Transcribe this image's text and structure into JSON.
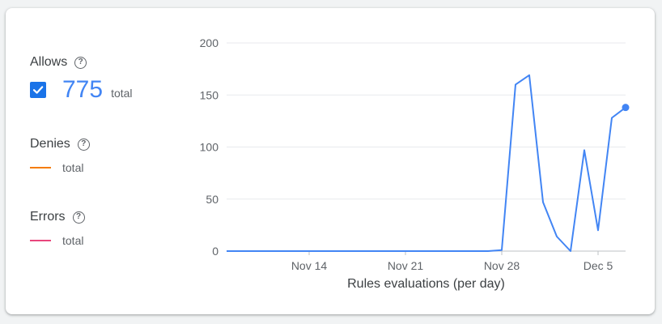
{
  "legend": {
    "allows": {
      "label": "Allows",
      "value": "775",
      "unit": "total",
      "checked": true
    },
    "denies": {
      "label": "Denies",
      "unit": "total",
      "color": "#f57c00"
    },
    "errors": {
      "label": "Errors",
      "unit": "total",
      "color": "#e8467c"
    },
    "help_glyph": "?"
  },
  "chart_data": {
    "type": "line",
    "xlabel": "Rules evaluations (per day)",
    "ylabel": "",
    "x_ticks": [
      "Nov 14",
      "Nov 21",
      "Nov 28",
      "Dec 5"
    ],
    "y_ticks": [
      0,
      50,
      100,
      150,
      200
    ],
    "ylim": [
      0,
      200
    ],
    "x_range": [
      "Nov 8",
      "Dec 7"
    ],
    "grid": true,
    "series": [
      {
        "name": "Allows",
        "color": "#4285f4",
        "x": [
          "Nov 8",
          "Nov 9",
          "Nov 10",
          "Nov 11",
          "Nov 12",
          "Nov 13",
          "Nov 14",
          "Nov 15",
          "Nov 16",
          "Nov 17",
          "Nov 18",
          "Nov 19",
          "Nov 20",
          "Nov 21",
          "Nov 22",
          "Nov 23",
          "Nov 24",
          "Nov 25",
          "Nov 26",
          "Nov 27",
          "Nov 28",
          "Nov 29",
          "Nov 30",
          "Dec 1",
          "Dec 2",
          "Dec 3",
          "Dec 4",
          "Dec 5",
          "Dec 6",
          "Dec 7"
        ],
        "values": [
          0,
          0,
          0,
          0,
          0,
          0,
          0,
          0,
          0,
          0,
          0,
          0,
          0,
          0,
          0,
          0,
          0,
          0,
          0,
          0,
          1,
          160,
          169,
          47,
          14,
          0,
          97,
          20,
          128,
          138
        ]
      }
    ]
  }
}
